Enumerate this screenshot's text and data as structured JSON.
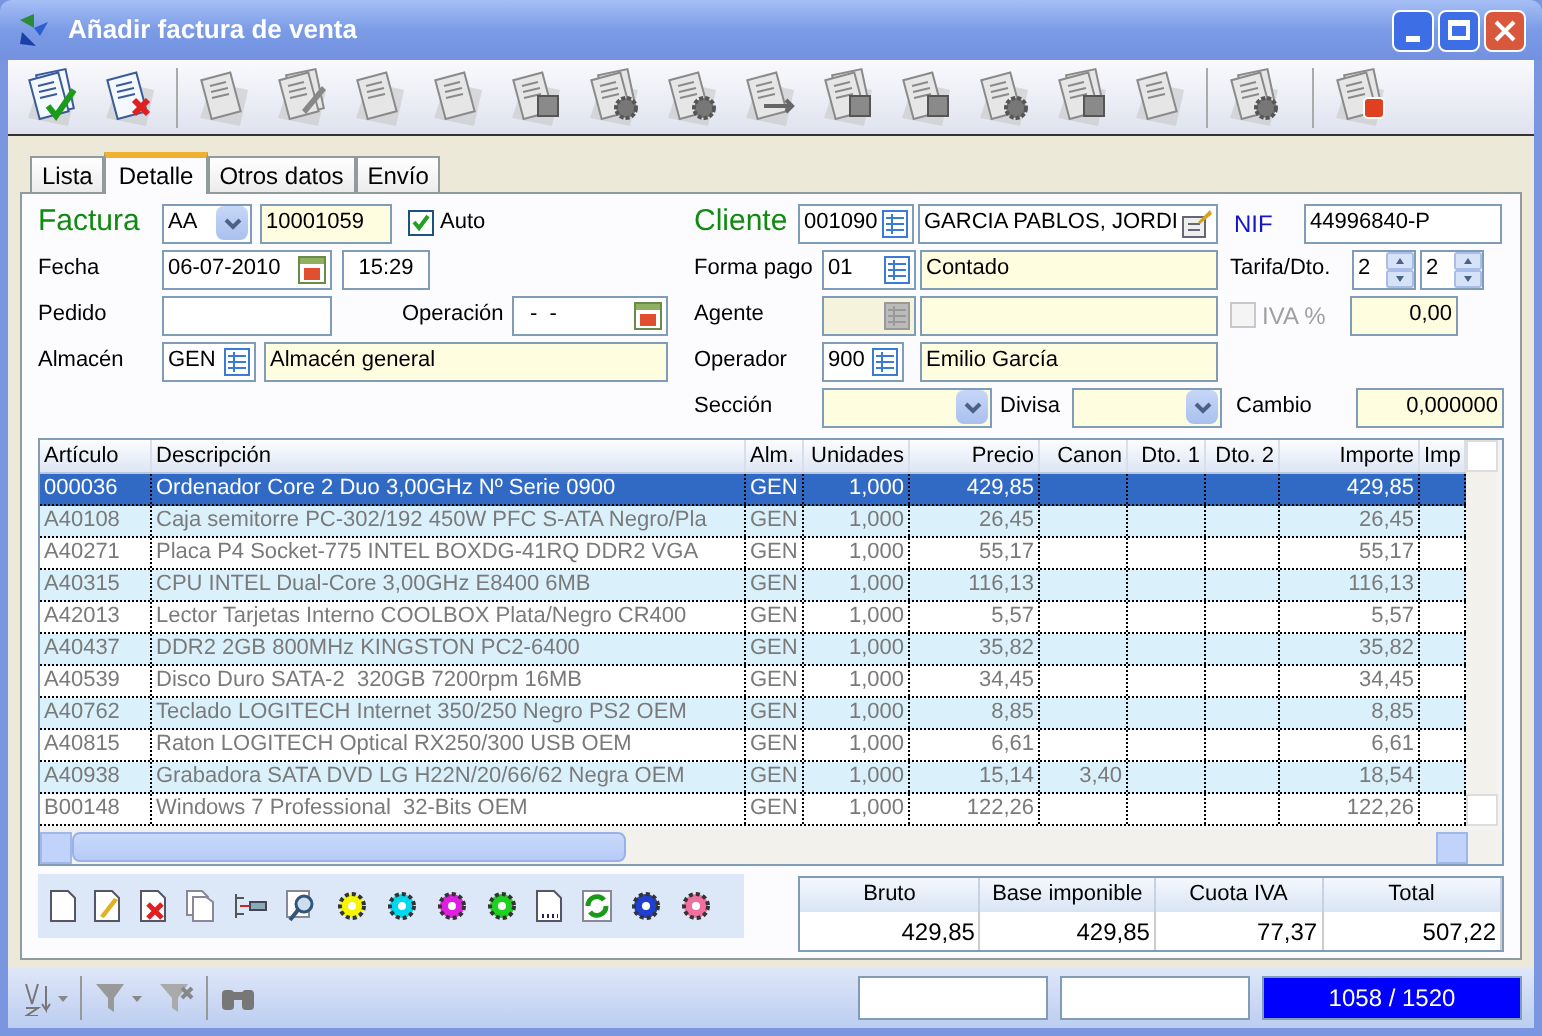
{
  "window": {
    "title": "Añadir factura de venta"
  },
  "tabs": [
    {
      "label": "Lista",
      "selected": false
    },
    {
      "label": "Detalle",
      "selected": true
    },
    {
      "label": "Otros datos",
      "selected": false
    },
    {
      "label": "Envío",
      "selected": false
    }
  ],
  "form": {
    "factura": {
      "label": "Factura",
      "series": "AA",
      "number": "10001059",
      "auto": {
        "label": "Auto",
        "checked": true
      }
    },
    "fecha": {
      "label": "Fecha",
      "date": "06-07-2010",
      "time": "15:29"
    },
    "pedido": {
      "label": "Pedido"
    },
    "operacion": {
      "label": "Operación",
      "value": "-  -"
    },
    "almacen": {
      "label": "Almacén",
      "code": "GEN",
      "name": "Almacén general"
    },
    "cliente": {
      "label": "Cliente",
      "code": "001090",
      "name": "GARCIA PABLOS, JORDI"
    },
    "nif": {
      "label": "NIF",
      "value": "44996840-P"
    },
    "forma_pago": {
      "label": "Forma pago",
      "code": "01",
      "name": "Contado"
    },
    "tarifa": {
      "label": "Tarifa/Dto.",
      "tarifa": "2",
      "dto": "2"
    },
    "agente": {
      "label": "Agente",
      "disabled": true
    },
    "iva": {
      "label": "IVA %",
      "checked": false,
      "disabled": true,
      "value": "0,00"
    },
    "operador": {
      "label": "Operador",
      "code": "900",
      "name": "Emilio García"
    },
    "seccion": {
      "label": "Sección"
    },
    "divisa": {
      "label": "Divisa"
    },
    "cambio": {
      "label": "Cambio",
      "value": "0,000000"
    }
  },
  "table": {
    "columns": [
      "Artículo",
      "Descripción",
      "Alm.",
      "Unidades",
      "Precio",
      "Canon",
      "Dto. 1",
      "Dto. 2",
      "Importe",
      "Imp"
    ],
    "rows": [
      {
        "selected": true,
        "cells": [
          "000036",
          "Ordenador Core 2 Duo 3,00GHz Nº Serie 0900",
          "GEN",
          "1,000",
          "429,85",
          "",
          "",
          "",
          "429,85",
          ""
        ]
      },
      {
        "selected": false,
        "cells": [
          "A40108",
          "Caja semitorre PC-302/192 450W PFC S-ATA Negro/Pla",
          "GEN",
          "1,000",
          "26,45",
          "",
          "",
          "",
          "26,45",
          ""
        ]
      },
      {
        "selected": false,
        "cells": [
          "A40271",
          "Placa P4 Socket-775 INTEL BOXDG-41RQ DDR2 VGA",
          "GEN",
          "1,000",
          "55,17",
          "",
          "",
          "",
          "55,17",
          ""
        ]
      },
      {
        "selected": false,
        "cells": [
          "A40315",
          "CPU INTEL Dual-Core 3,00GHz E8400 6MB",
          "GEN",
          "1,000",
          "116,13",
          "",
          "",
          "",
          "116,13",
          ""
        ]
      },
      {
        "selected": false,
        "cells": [
          "A42013",
          "Lector Tarjetas Interno COOLBOX Plata/Negro CR400",
          "GEN",
          "1,000",
          "5,57",
          "",
          "",
          "",
          "5,57",
          ""
        ]
      },
      {
        "selected": false,
        "cells": [
          "A40437",
          "DDR2 2GB 800MHz KINGSTON PC2-6400",
          "GEN",
          "1,000",
          "35,82",
          "",
          "",
          "",
          "35,82",
          ""
        ]
      },
      {
        "selected": false,
        "cells": [
          "A40539",
          "Disco Duro SATA-2  320GB 7200rpm 16MB",
          "GEN",
          "1,000",
          "34,45",
          "",
          "",
          "",
          "34,45",
          ""
        ]
      },
      {
        "selected": false,
        "cells": [
          "A40762",
          "Teclado LOGITECH Internet 350/250 Negro PS2 OEM",
          "GEN",
          "1,000",
          "8,85",
          "",
          "",
          "",
          "8,85",
          ""
        ]
      },
      {
        "selected": false,
        "cells": [
          "A40815",
          "Raton LOGITECH Optical RX250/300 USB OEM",
          "GEN",
          "1,000",
          "6,61",
          "",
          "",
          "",
          "6,61",
          ""
        ]
      },
      {
        "selected": false,
        "cells": [
          "A40938",
          "Grabadora SATA DVD LG H22N/20/66/62 Negra OEM",
          "GEN",
          "1,000",
          "15,14",
          "3,40",
          "",
          "",
          "18,54",
          ""
        ]
      },
      {
        "selected": false,
        "cells": [
          "B00148",
          "Windows 7 Professional  32-Bits OEM",
          "GEN",
          "1,000",
          "122,26",
          "",
          "",
          "",
          "122,26",
          ""
        ]
      }
    ]
  },
  "totals": {
    "columns": [
      "Bruto",
      "Base imponible",
      "Cuota IVA",
      "Total"
    ],
    "values": [
      "429,85",
      "429,85",
      "77,37",
      "507,22"
    ]
  },
  "status_bar": {
    "counter": "1058 / 1520"
  }
}
